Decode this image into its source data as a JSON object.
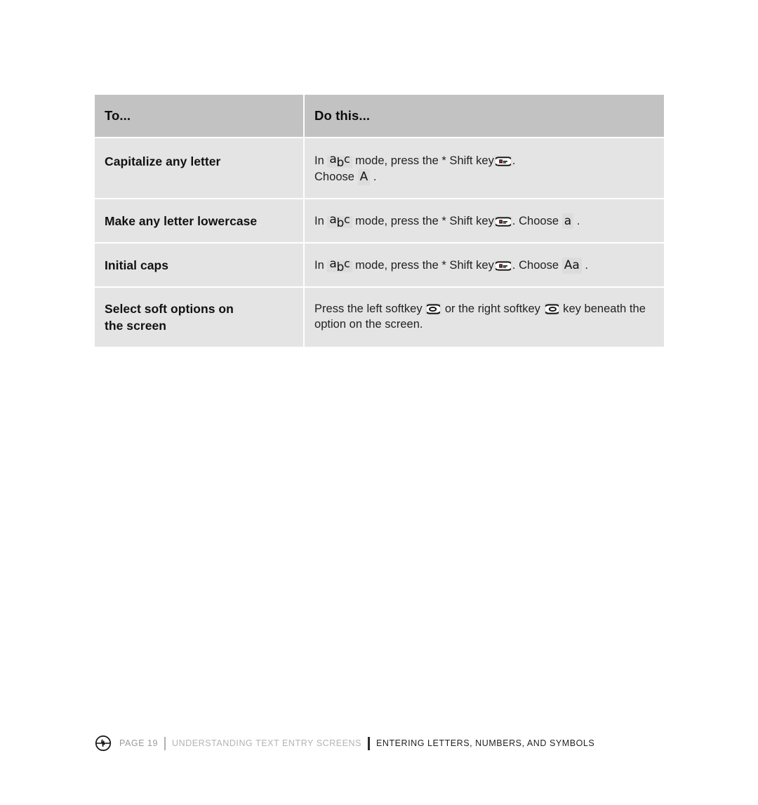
{
  "table": {
    "header": {
      "col1": "To...",
      "col2": "Do this..."
    },
    "rows": [
      {
        "label": "Capitalize any letter",
        "parts": {
          "p1": "In",
          "mode_glyph": "abc",
          "p2": "mode, press the * Shift key",
          "key_icon": "shift-key-icon",
          "p3": ".",
          "p4": "Choose",
          "choice": "A",
          "p5": "."
        }
      },
      {
        "label": "Make any letter lowercase",
        "parts": {
          "p1": "In",
          "mode_glyph": "abc",
          "p2": "mode, press the * Shift key",
          "key_icon": "shift-key-icon",
          "p3": ". Choose",
          "choice": "a",
          "p5": "."
        }
      },
      {
        "label": "Initial caps",
        "parts": {
          "p1": "In",
          "mode_glyph": "abc",
          "p2": "mode, press the * Shift key",
          "key_icon": "shift-key-icon",
          "p3": ". Choose",
          "choice": "Aa",
          "p5": "."
        }
      },
      {
        "label_line1": "Select soft options on",
        "label_line2": "the screen",
        "parts": {
          "p1": "Press the left softkey",
          "left_softkey_icon": "left-softkey-icon",
          "p2": "or the right softkey",
          "right_softkey_icon": "right-softkey-icon",
          "p3": "key beneath the",
          "p4": "option on the screen."
        }
      }
    ]
  },
  "footer": {
    "logo": "signal-circle-logo",
    "page": "PAGE 19",
    "section": "UNDERSTANDING TEXT ENTRY SCREENS",
    "subsection": "ENTERING LETTERS, NUMBERS, AND SYMBOLS"
  },
  "colors": {
    "header_bg": "#c2c2c2",
    "cell_bg": "#e4e4e4",
    "chip_bg": "#dcdcdc",
    "page_bg": "#ffffff",
    "footer_muted": "#b3b3b3",
    "footer_dark": "#1f1f1f",
    "key_accent": "#c0392b"
  }
}
